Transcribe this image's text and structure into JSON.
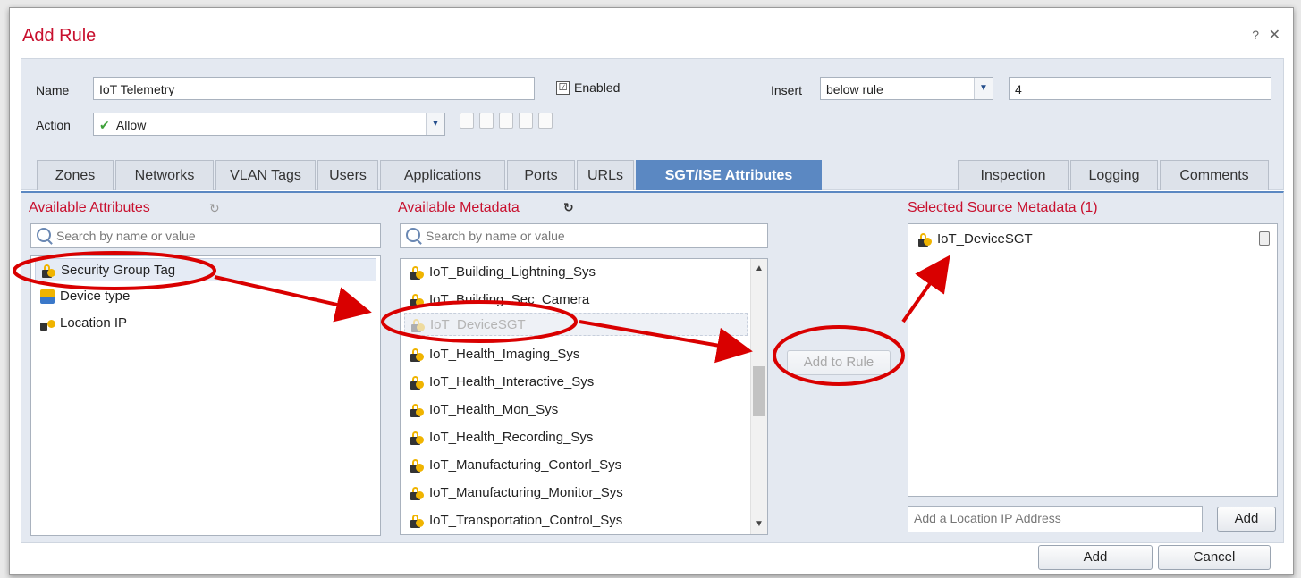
{
  "dialog": {
    "title": "Add Rule",
    "help": "?",
    "close": "✕"
  },
  "form": {
    "name_label": "Name",
    "name_value": "IoT Telemetry",
    "enabled_label": "Enabled",
    "enabled_checked": "☑",
    "insert_label": "Insert",
    "insert_value": "below rule",
    "insert_position": "4",
    "action_label": "Action",
    "action_value": "Allow",
    "action_icon": "checkmark-icon"
  },
  "tabs": [
    "Zones",
    "Networks",
    "VLAN Tags",
    "Users",
    "Applications",
    "Ports",
    "URLs",
    "SGT/ISE Attributes",
    "Inspection",
    "Logging",
    "Comments"
  ],
  "active_tab": "SGT/ISE Attributes",
  "available_attributes": {
    "title": "Available Attributes",
    "search_placeholder": "Search by name or value",
    "items": [
      "Security Group Tag",
      "Device type",
      "Location IP"
    ]
  },
  "available_metadata": {
    "title": "Available Metadata",
    "search_placeholder": "Search by name or value",
    "items": [
      "IoT_Building_Lightning_Sys",
      "IoT_Building_Sec_Camera",
      "IoT_DeviceSGT",
      "IoT_Health_Imaging_Sys",
      "IoT_Health_Interactive_Sys",
      "IoT_Health_Mon_Sys",
      "IoT_Health_Recording_Sys",
      "IoT_Manufacturing_Contorl_Sys",
      "IoT_Manufacturing_Monitor_Sys",
      "IoT_Transportation_Control_Sys"
    ]
  },
  "add_to_rule_label": "Add to Rule",
  "selected": {
    "title": "Selected Source Metadata (1)",
    "items": [
      "IoT_DeviceSGT"
    ],
    "location_placeholder": "Add a Location IP Address",
    "add_label": "Add"
  },
  "footer": {
    "add_label": "Add",
    "cancel_label": "Cancel"
  },
  "colors": {
    "accent_red": "#c8102e",
    "tab_active": "#5b88c2",
    "annotation_red": "#d90000"
  }
}
